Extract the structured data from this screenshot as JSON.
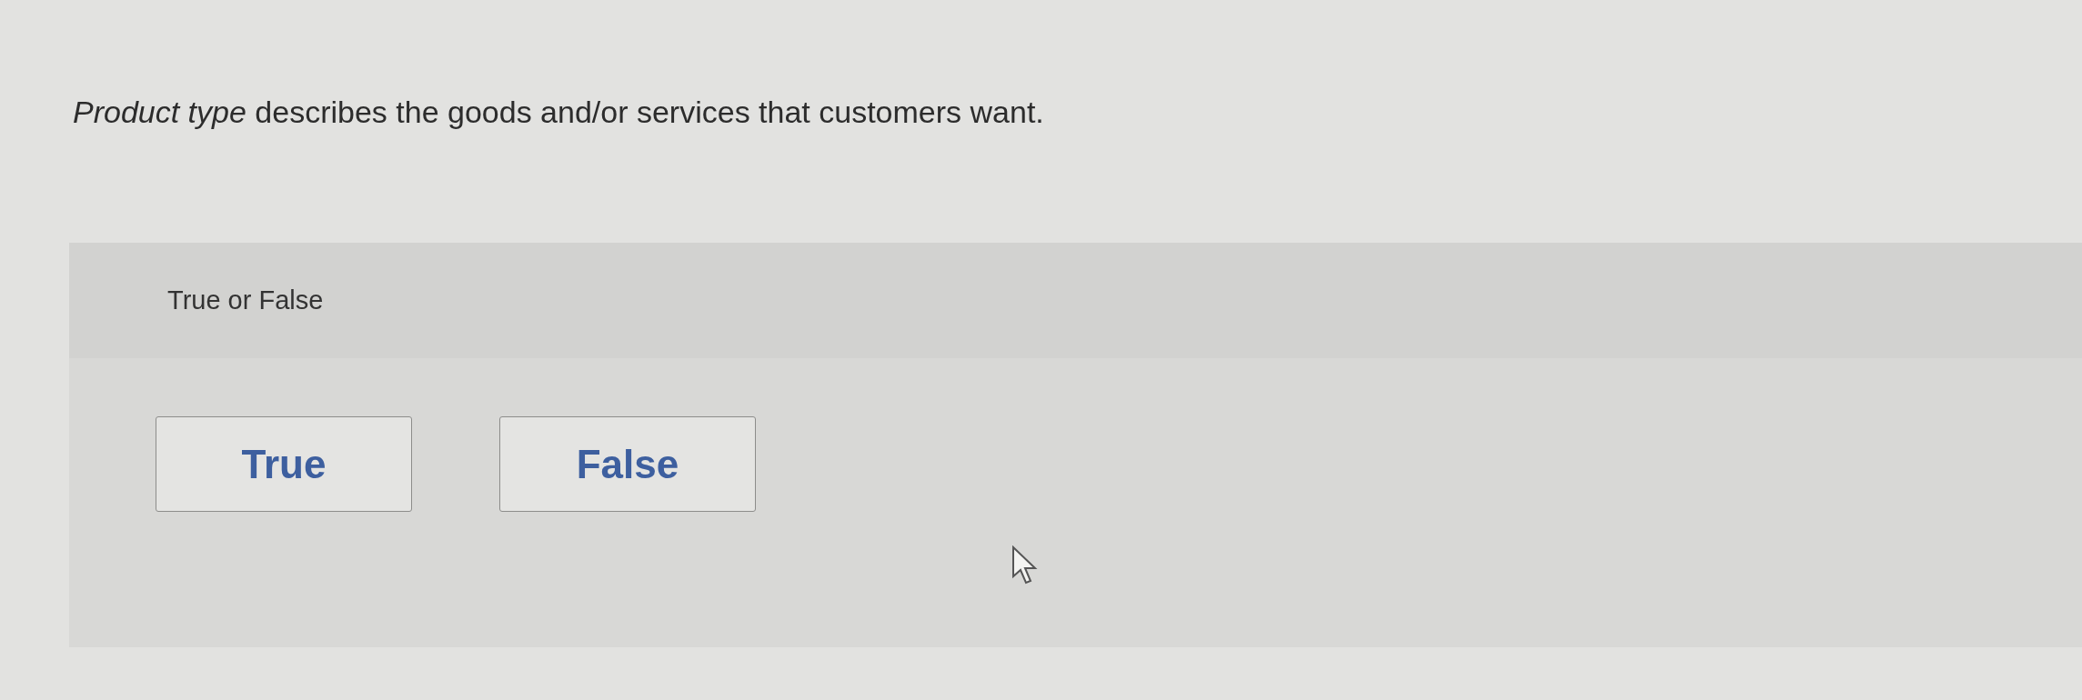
{
  "question": "*Product type* describes the goods and/or services that customers want.",
  "prompt": "True or False",
  "options": [
    {
      "label": "True",
      "selected": false
    },
    {
      "label": "False",
      "selected": false
    }
  ]
}
